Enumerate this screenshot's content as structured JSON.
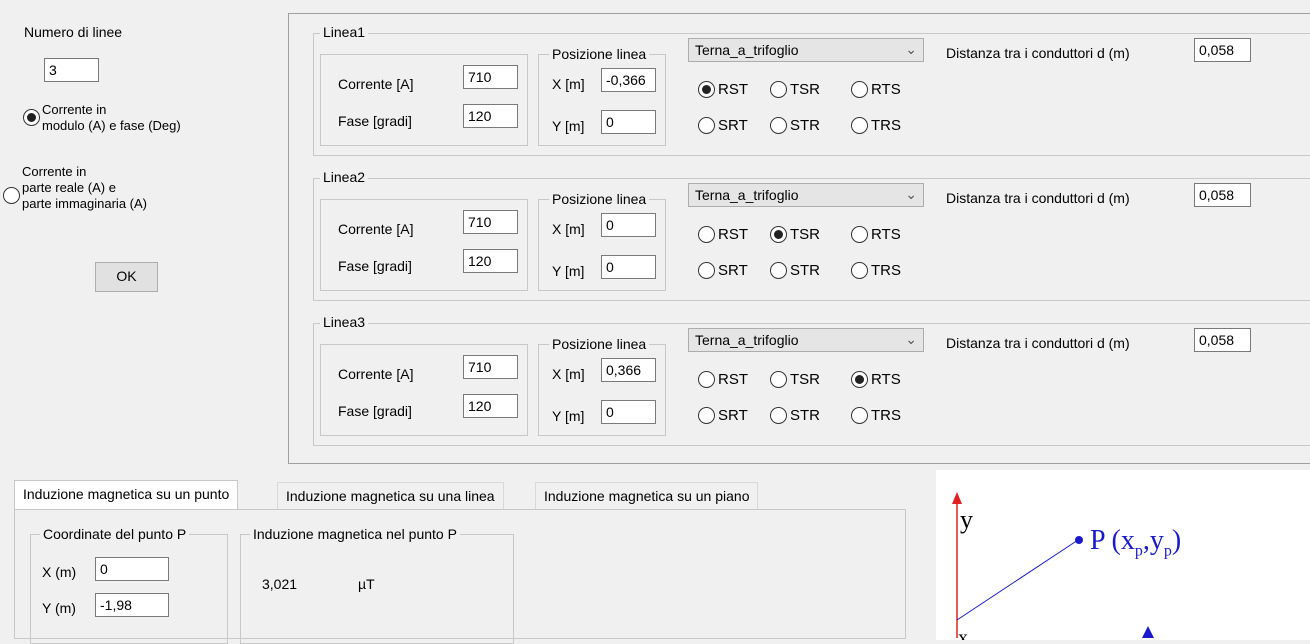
{
  "left": {
    "num_lines_label": "Numero di linee",
    "num_lines_value": "3",
    "radio1_line1": "Corrente in",
    "radio1_line2": "modulo (A) e fase (Deg)",
    "radio2_line1": "Corrente in",
    "radio2_line2": "parte reale (A) e",
    "radio2_line3": "parte immaginaria (A)",
    "ok_label": "OK"
  },
  "lines": [
    {
      "title": "Linea1",
      "corrente_label": "Corrente [A]",
      "corrente": "710",
      "fase_label": "Fase [gradi]",
      "fase": "120",
      "pos_label": "Posizione linea",
      "x_label": "X [m]",
      "x": "-0,366",
      "y_label": "Y [m]",
      "y": "0",
      "combo": "Terna_a_trifoglio",
      "dist_label": "Distanza tra i conduttori d (m)",
      "dist": "0,058",
      "r1": "RST",
      "r2": "TSR",
      "r3": "RTS",
      "r4": "SRT",
      "r5": "STR",
      "r6": "TRS"
    },
    {
      "title": "Linea2",
      "corrente_label": "Corrente [A]",
      "corrente": "710",
      "fase_label": "Fase [gradi]",
      "fase": "120",
      "pos_label": "Posizione linea",
      "x_label": "X [m]",
      "x": "0",
      "y_label": "Y [m]",
      "y": "0",
      "combo": "Terna_a_trifoglio",
      "dist_label": "Distanza tra i conduttori d (m)",
      "dist": "0,058",
      "r1": "RST",
      "r2": "TSR",
      "r3": "RTS",
      "r4": "SRT",
      "r5": "STR",
      "r6": "TRS"
    },
    {
      "title": "Linea3",
      "corrente_label": "Corrente [A]",
      "corrente": "710",
      "fase_label": "Fase [gradi]",
      "fase": "120",
      "pos_label": "Posizione linea",
      "x_label": "X [m]",
      "x": "0,366",
      "y_label": "Y [m]",
      "y": "0",
      "combo": "Terna_a_trifoglio",
      "dist_label": "Distanza tra i conduttori d (m)",
      "dist": "0,058",
      "r1": "RST",
      "r2": "TSR",
      "r3": "RTS",
      "r4": "SRT",
      "r5": "STR",
      "r6": "TRS"
    }
  ],
  "tabs": [
    "Induzione magnetica su un punto",
    "Induzione magnetica su una linea",
    "Induzione magnetica su un piano"
  ],
  "point": {
    "coord_title": "Coordinate del punto P",
    "x_label": "X (m)",
    "x": "0",
    "y_label": "Y (m)",
    "y": "-1,98",
    "result_title": "Induzione magnetica nel punto P",
    "result_value": "3,021",
    "result_unit": "µT"
  },
  "diagram": {
    "y_label": "y",
    "point_label": "P (x",
    "sub_p1": "p",
    "comma": ",y",
    "sub_p2": "p",
    "close": ")",
    "x_label": "x"
  },
  "colors": {
    "axis": "#e02020",
    "point": "#1a1acc",
    "radio_checked": "#222222"
  }
}
